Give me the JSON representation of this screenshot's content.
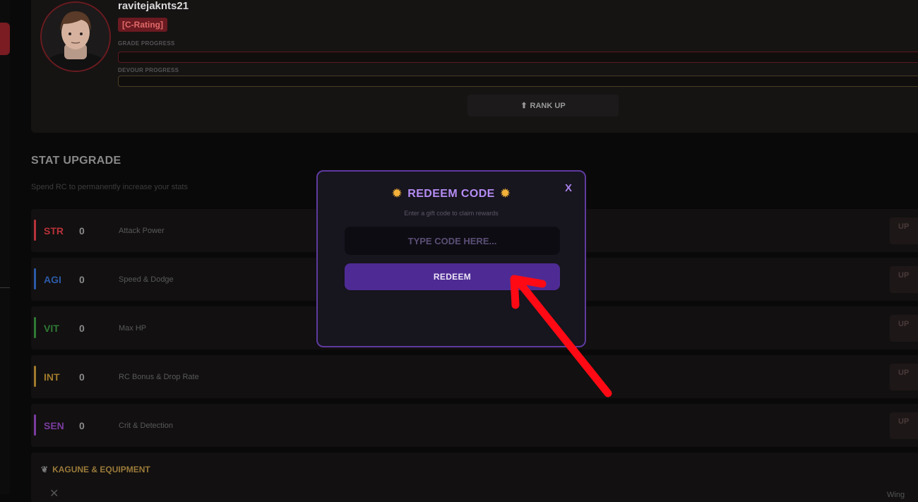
{
  "profile": {
    "username": "ravitejaknts21",
    "rating_badge": "[C-Rating]",
    "grade_progress_label": "GRADE PROGRESS",
    "devour_progress_label": "DEVOUR PROGRESS",
    "rank_up_label": "RANK UP"
  },
  "stat_upgrade": {
    "title": "STAT UPGRADE",
    "subtitle": "Spend RC to permanently increase your stats",
    "up_label": "UP",
    "stats": [
      {
        "name": "STR",
        "value": "0",
        "description": "Attack Power",
        "color": "#b8323a"
      },
      {
        "name": "AGI",
        "value": "0",
        "description": "Speed & Dodge",
        "color": "#2c5aa8"
      },
      {
        "name": "VIT",
        "value": "0",
        "description": "Max HP",
        "color": "#2f7a35"
      },
      {
        "name": "INT",
        "value": "0",
        "description": "RC Bonus & Drop Rate",
        "color": "#a07a2c"
      },
      {
        "name": "SEN",
        "value": "0",
        "description": "Crit & Detection",
        "color": "#7a3ca0"
      }
    ]
  },
  "kagune": {
    "title": "KAGUNE & EQUIPMENT",
    "row_right_text": "Wing"
  },
  "modal": {
    "title": "REDEEM CODE",
    "subtitle": "Enter a gift code to claim rewards",
    "close_label": "X",
    "input_placeholder": "TYPE CODE HERE...",
    "redeem_label": "REDEEM"
  },
  "colors": {
    "accent_purple": "#5e3aa0",
    "redeem_button": "#4e2b94",
    "annotation_arrow": "#ff0a14"
  }
}
